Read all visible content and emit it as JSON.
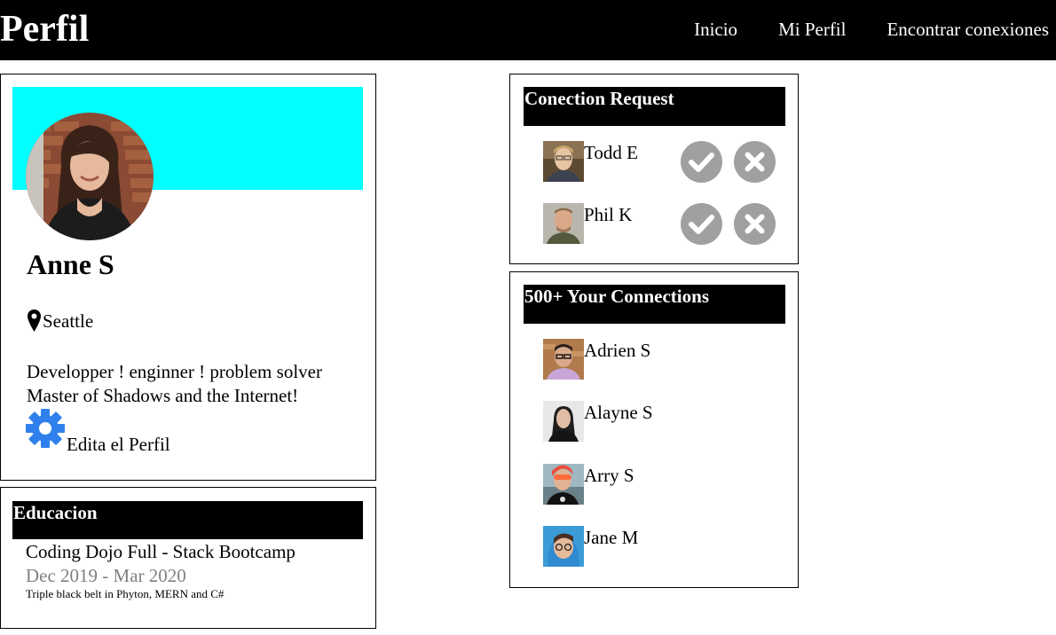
{
  "header": {
    "brand": "Perfil",
    "nav": [
      "Inicio",
      "Mi Perfil",
      "Encontrar conexiones"
    ]
  },
  "profile": {
    "name": "Anne S",
    "location": "Seattle",
    "bio_line1": "Developper ! enginner ! problem solver",
    "bio_line2": "Master of Shadows and the Internet!",
    "edit_label": "Edita el Perfil",
    "banner_color": "#00ffff",
    "edit_icon_color": "#2f80ed"
  },
  "education": {
    "heading": "Educacion",
    "title": "Coding Dojo Full - Stack Bootcamp",
    "dates": "Dec 2019 - Mar 2020",
    "note": "Triple black belt in Phyton, MERN and C#"
  },
  "requests": {
    "heading": "Conection Request",
    "people": [
      {
        "name": "Todd E"
      },
      {
        "name": "Phil K"
      }
    ],
    "accept_icon": "check-circle-icon",
    "reject_icon": "x-circle-icon",
    "button_color": "#a0a0a0"
  },
  "connections": {
    "heading": "500+ Your Connections",
    "people": [
      {
        "name": "Adrien S"
      },
      {
        "name": "Alayne S"
      },
      {
        "name": "Arry S"
      },
      {
        "name": "Jane M"
      }
    ]
  }
}
